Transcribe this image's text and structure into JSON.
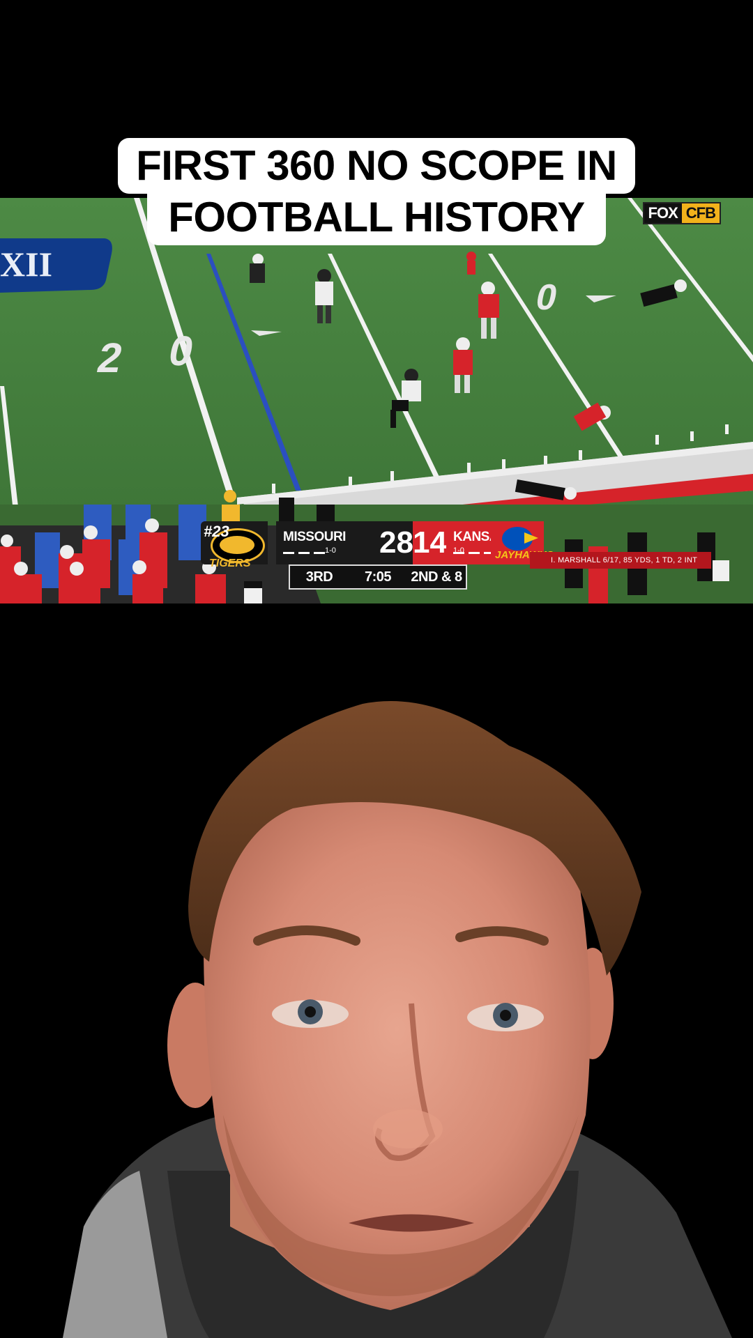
{
  "caption": {
    "line1": "FIRST 360 NO SCOPE IN",
    "line2": "FOOTBALL HISTORY"
  },
  "broadcast": {
    "network_left": "FOX",
    "network_right": "CFB",
    "field_marks": [
      "20",
      "0"
    ],
    "conference_logo": "XII"
  },
  "scorebug": {
    "away_rank": "#23",
    "away_team": "MISSOURI",
    "away_record": "1-0",
    "away_score": "28",
    "home_score": "14",
    "home_team": "KANSAS",
    "home_record": "1-0",
    "away_logo_text": "TIGERS",
    "home_logo_text": "JAYHAWKS",
    "period": "3RD",
    "clock": "7:05",
    "down_distance": "2ND & 8",
    "stat_line": "I. MARSHALL   6/17, 85 YDS, 1 TD, 2 INT"
  },
  "colors": {
    "missouri_gold": "#f1b82d",
    "kansas_red": "#d6232a",
    "kansas_blue": "#0051ba",
    "field_green": "#3f7a3a"
  }
}
